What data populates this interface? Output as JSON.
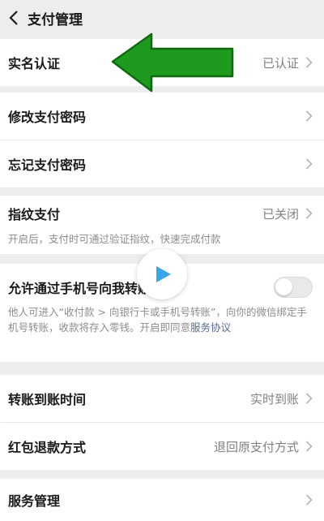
{
  "header": {
    "title": "支付管理",
    "back_icon": "chevron-left-icon"
  },
  "rows": {
    "realname": {
      "label": "实名认证",
      "value": "已认证"
    },
    "change_pwd": {
      "label": "修改支付密码"
    },
    "forgot_pwd": {
      "label": "忘记支付密码"
    },
    "fingerprint": {
      "label": "指纹支付",
      "value": "已关闭",
      "desc": "开启后，支付时可通过验证指纹，快速完成付款"
    },
    "allow_phone": {
      "label": "允许通过手机号向我转账",
      "desc_main": "他人可进入“收付款 > 向银行卡或手机号转账”，向你的微信绑定手机号转账，收款将存入零钱。开启即同意",
      "desc_link": "服务协议",
      "enabled": false
    },
    "arrival_time": {
      "label": "转账到账时间",
      "value": "实时到账"
    },
    "refund_method": {
      "label": "红包退款方式",
      "value": "退回原支付方式"
    },
    "service_mgmt": {
      "label": "服务管理"
    }
  },
  "overlays": {
    "arrow_icon": "green-arrow-icon",
    "play_icon": "play-icon"
  },
  "colors": {
    "arrow_green": "#1e9b1e",
    "link": "#576b95",
    "play_blue": "#3aa6e8"
  }
}
